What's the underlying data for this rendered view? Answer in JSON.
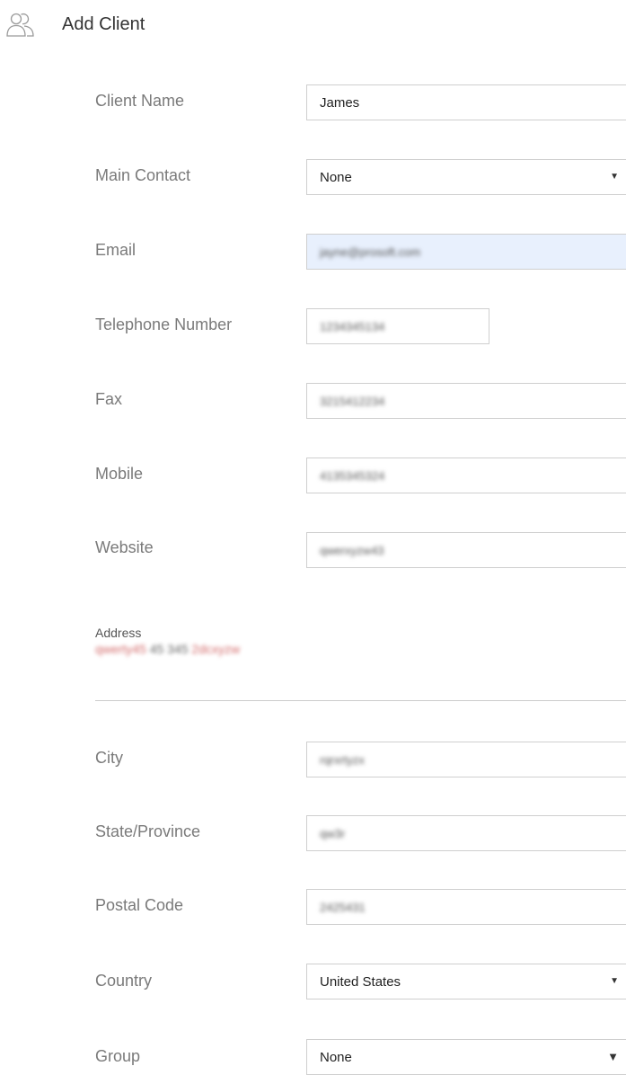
{
  "header": {
    "title": "Add Client",
    "icon": "users-icon"
  },
  "fields": {
    "client_name": {
      "label": "Client Name",
      "value": "James"
    },
    "main_contact": {
      "label": "Main Contact",
      "value": "None"
    },
    "email": {
      "label": "Email",
      "value": "jayne@prosoft.com"
    },
    "telephone": {
      "label": "Telephone Number",
      "value": "1234345134"
    },
    "fax": {
      "label": "Fax",
      "value": "3215412234"
    },
    "mobile": {
      "label": "Mobile",
      "value": "4135345324"
    },
    "website": {
      "label": "Website",
      "value": "qwerxyzw43"
    },
    "address": {
      "label": "Address",
      "value_a": "qwerty45",
      "value_b": "45 345",
      "value_c": "2dcxyzw"
    },
    "city": {
      "label": "City",
      "value": "rqrxrtyzx"
    },
    "state": {
      "label": "State/Province",
      "value": "qw3r"
    },
    "postal": {
      "label": "Postal Code",
      "value": "2425431"
    },
    "country": {
      "label": "Country",
      "value": "United States"
    },
    "group": {
      "label": "Group",
      "value": "None"
    }
  },
  "colors": {
    "autofill_bg": "#e8f0fd",
    "border": "#cfcfcf",
    "label": "#7a7a7a"
  }
}
